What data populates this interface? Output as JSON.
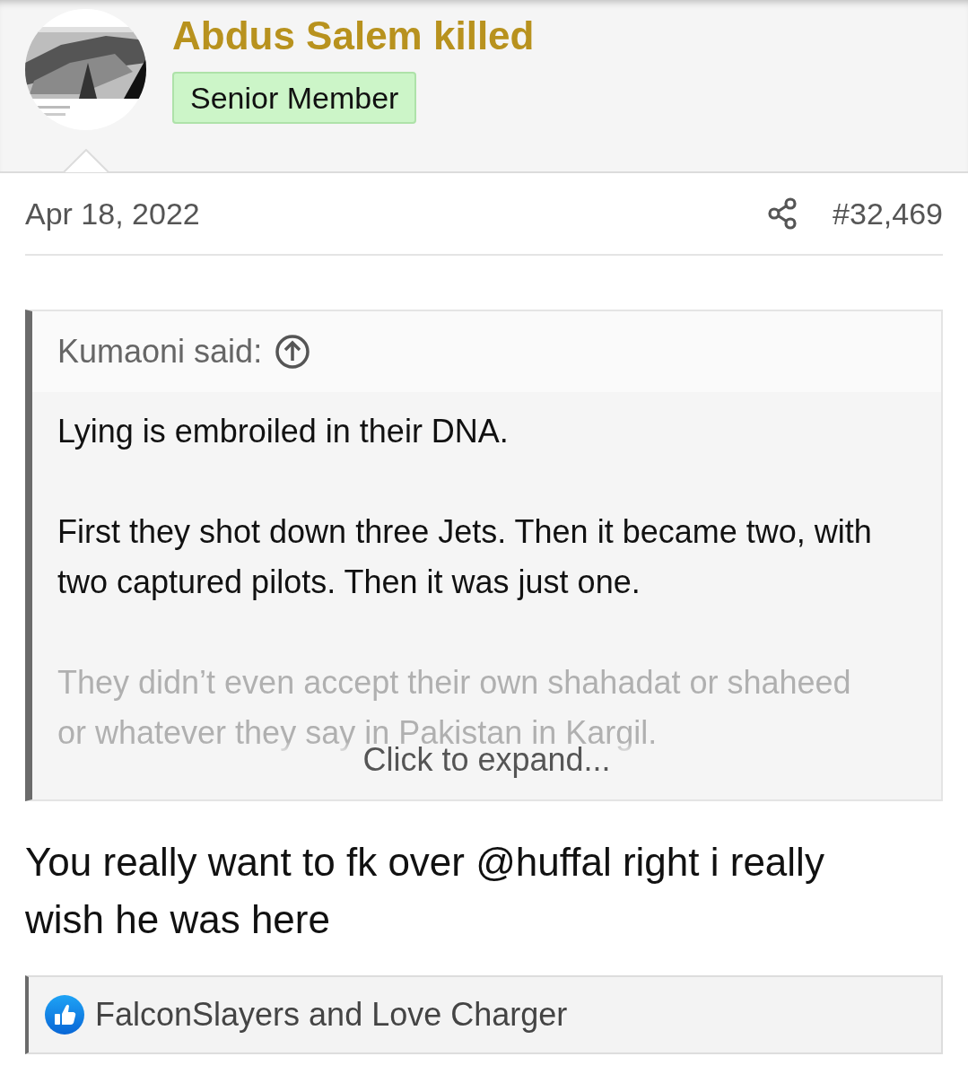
{
  "post": {
    "author": {
      "name": "Abdus Salem killed",
      "title": "Senior Member"
    },
    "date": "Apr 18, 2022",
    "number": "#32,469",
    "quote": {
      "author": "Kumaoni said:",
      "paragraphs": [
        {
          "text": "Lying is embroiled in their DNA.",
          "faded": false
        },
        {
          "text": "First they shot down three Jets. Then it became two, with two captured pilots. Then it was just one.",
          "faded": false
        },
        {
          "text": "They didn’t even accept their own shahadat or shaheed or whatever they say in Pakistan in Kargil.",
          "faded": true
        }
      ],
      "expand_label": "Click to expand..."
    },
    "message": "You really want to fk over @huffal right i really wish he was here",
    "reactions": {
      "text": "FalconSlayers and Love Charger"
    }
  }
}
